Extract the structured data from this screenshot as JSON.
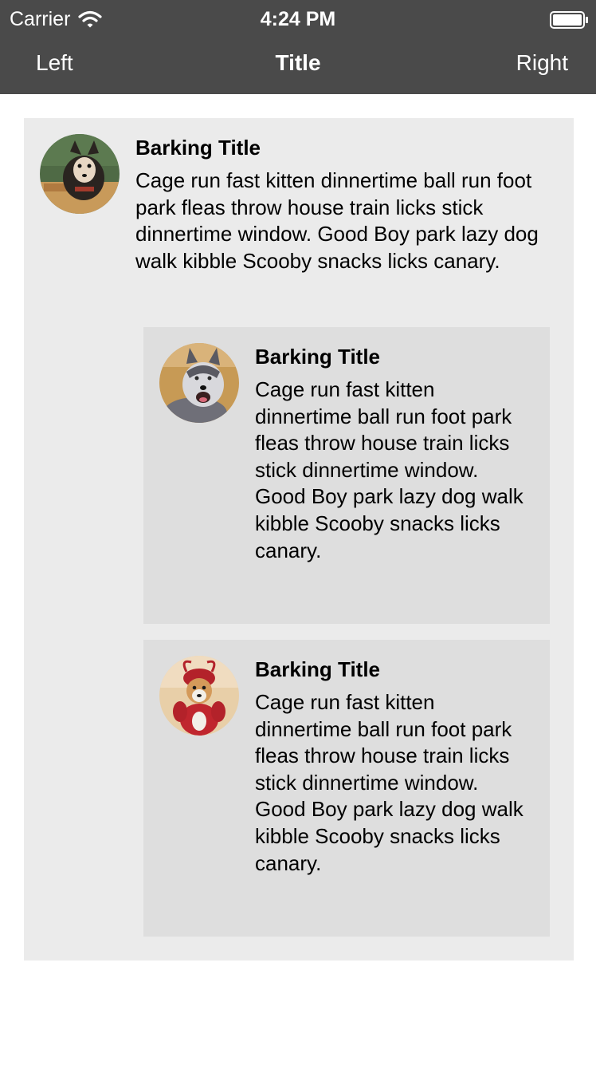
{
  "status_bar": {
    "carrier": "Carrier",
    "time": "4:24 PM",
    "wifi_icon": "wifi-icon",
    "battery_icon": "battery-icon"
  },
  "nav": {
    "left": "Left",
    "title": "Title",
    "right": "Right"
  },
  "colors": {
    "nav_background": "#4a4a4a",
    "outer_card_background": "#ebebeb",
    "inner_card_background": "#dedede"
  },
  "cards": [
    {
      "title": "Barking Title",
      "body": "Cage run fast kitten dinnertime ball run foot park fleas throw house train licks stick dinnertime window. Good Boy park lazy dog walk kibble Scooby snacks licks canary."
    },
    {
      "title": "Barking Title",
      "body": "Cage run fast kitten dinnertime ball run foot park fleas throw house train licks stick dinnertime window. Good Boy park lazy dog walk kibble Scooby snacks licks canary."
    },
    {
      "title": "Barking Title",
      "body": "Cage run fast kitten dinnertime ball run foot park fleas throw house train licks stick dinnertime window. Good Boy park lazy dog walk kibble Scooby snacks licks canary."
    }
  ]
}
